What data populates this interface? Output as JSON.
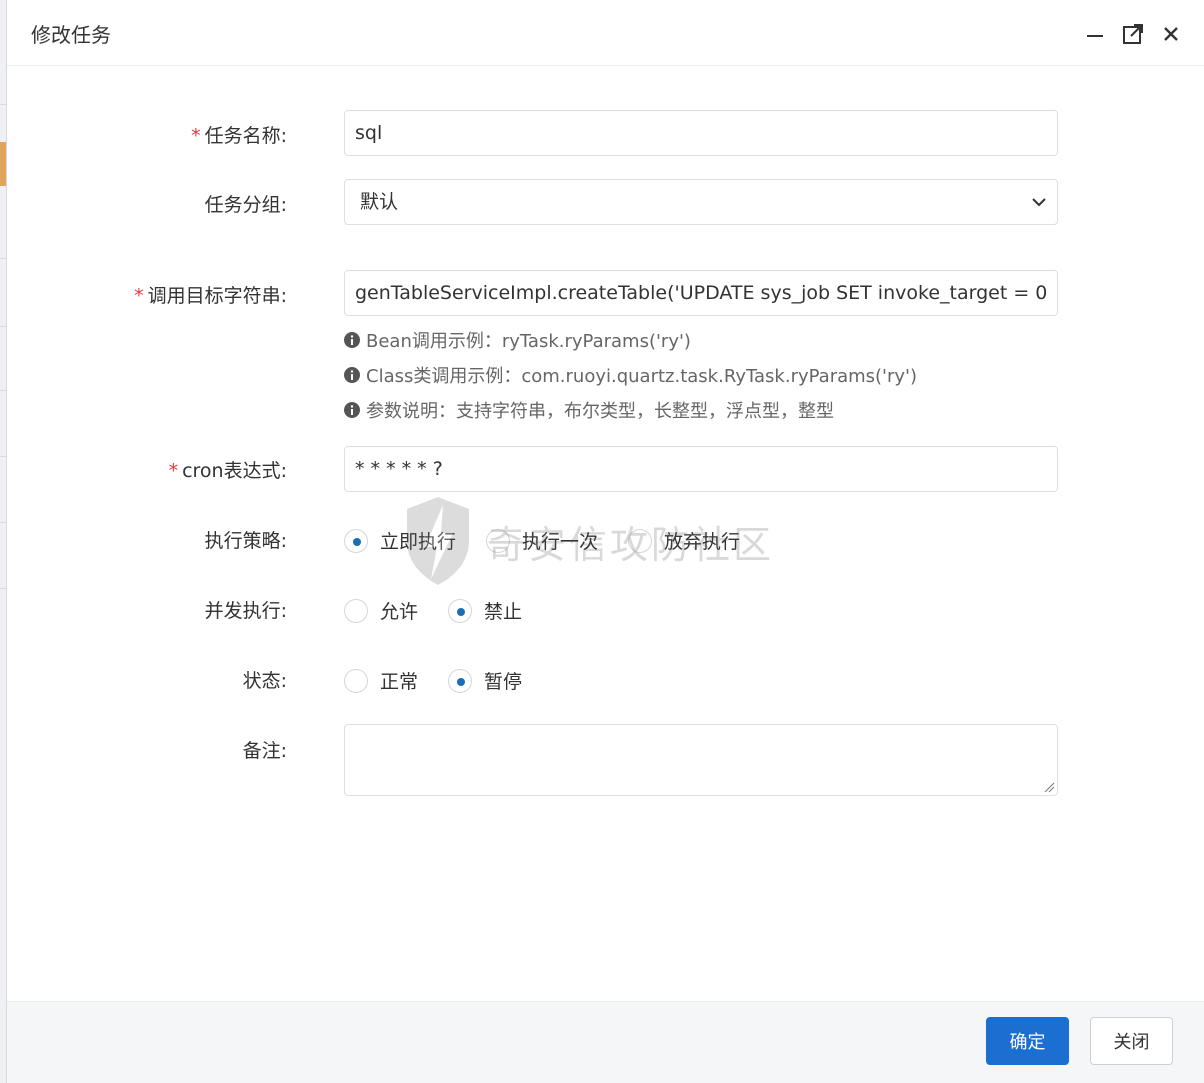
{
  "dialog": {
    "title": "修改任务",
    "icons": {
      "minimize": "minimize-icon",
      "maximize": "maximize-icon",
      "close": "close-icon"
    }
  },
  "form": {
    "job_name": {
      "label": "任务名称:",
      "required_mark": "*",
      "value": "sql"
    },
    "job_group": {
      "label": "任务分组:",
      "value": "默认"
    },
    "invoke_target": {
      "label": "调用目标字符串:",
      "required_mark": "*",
      "value": "genTableServiceImpl.createTable('UPDATE sys_job SET invoke_target = 0",
      "help": [
        "Bean调用示例：ryTask.ryParams('ry')",
        "Class类调用示例：com.ruoyi.quartz.task.RyTask.ryParams('ry')",
        "参数说明：支持字符串，布尔类型，长整型，浮点型，整型"
      ]
    },
    "cron": {
      "label": "cron表达式:",
      "required_mark": "*",
      "value": "* * * * * ?"
    },
    "misfire_policy": {
      "label": "执行策略:",
      "options": [
        "立即执行",
        "执行一次",
        "放弃执行"
      ],
      "selected": "立即执行"
    },
    "concurrent": {
      "label": "并发执行:",
      "options": [
        "允许",
        "禁止"
      ],
      "selected": "禁止"
    },
    "status": {
      "label": "状态:",
      "options": [
        "正常",
        "暂停"
      ],
      "selected": "暂停"
    },
    "remark": {
      "label": "备注:",
      "value": ""
    }
  },
  "watermark": {
    "text": "奇安信攻防社区"
  },
  "footer": {
    "confirm_label": "确定",
    "close_label": "关闭"
  },
  "colors": {
    "primary": "#1a6fd0",
    "required": "#e4393c",
    "radio_dot": "#1a6fb4"
  }
}
